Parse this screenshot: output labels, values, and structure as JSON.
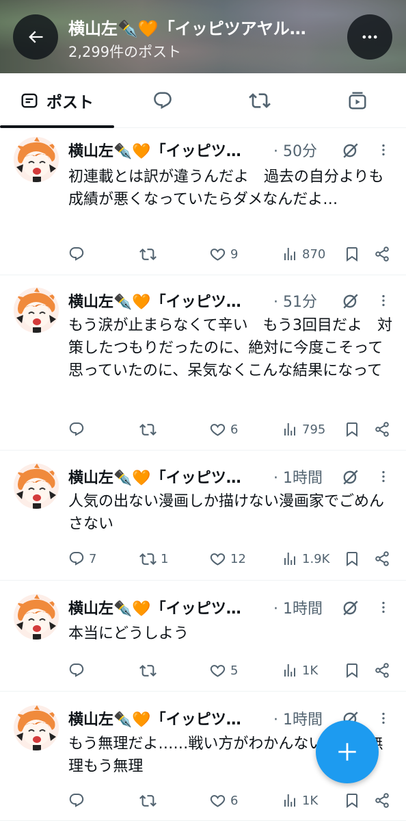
{
  "header": {
    "title": "横山左✒️🧡「イッピツアヤル…",
    "post_count": "2,299件のポスト"
  },
  "tabs": [
    {
      "label": "ポスト",
      "icon": "posts-icon",
      "active": true
    },
    {
      "label": "",
      "icon": "replies-icon",
      "active": false
    },
    {
      "label": "",
      "icon": "reposts-icon",
      "active": false
    },
    {
      "label": "",
      "icon": "media-icon",
      "active": false
    }
  ],
  "colors": {
    "accent": "#1d9bf0",
    "text": "#0f1419",
    "muted": "#536471"
  },
  "posts": [
    {
      "author": "横山左✒️🧡「イッピツ…",
      "time": "· 50分",
      "text": "初連載とは訳が違うんだよ　過去の自分よりも成績が悪くなっていたらダメなんだよ…",
      "replies": "",
      "reposts": "",
      "likes": "9",
      "views": "870"
    },
    {
      "author": "横山左✒️🧡「イッピツ…",
      "time": "· 51分",
      "text": "もう涙が止まらなくて辛い　もう3回目だよ　対策したつもりだったのに、絶対に今度こそって思っていたのに、呆気なくこんな結果になって",
      "replies": "",
      "reposts": "",
      "likes": "6",
      "views": "795"
    },
    {
      "author": "横山左✒️🧡「イッピツ…",
      "time": "· 1時間",
      "text": "人気の出ない漫画しか描けない漫画家でごめんさない",
      "replies": "7",
      "reposts": "1",
      "likes": "12",
      "views": "1.9K"
    },
    {
      "author": "横山左✒️🧡「イッピツ…",
      "time": "· 1時間",
      "text": "本当にどうしよう",
      "replies": "",
      "reposts": "",
      "likes": "5",
      "views": "1K"
    },
    {
      "author": "横山左✒️🧡「イッピツ…",
      "time": "· 1時間",
      "text": "もう無理だよ……戦い方がわかんない　もう無理もう無理",
      "replies": "",
      "reposts": "",
      "likes": "6",
      "views": "1K"
    }
  ]
}
